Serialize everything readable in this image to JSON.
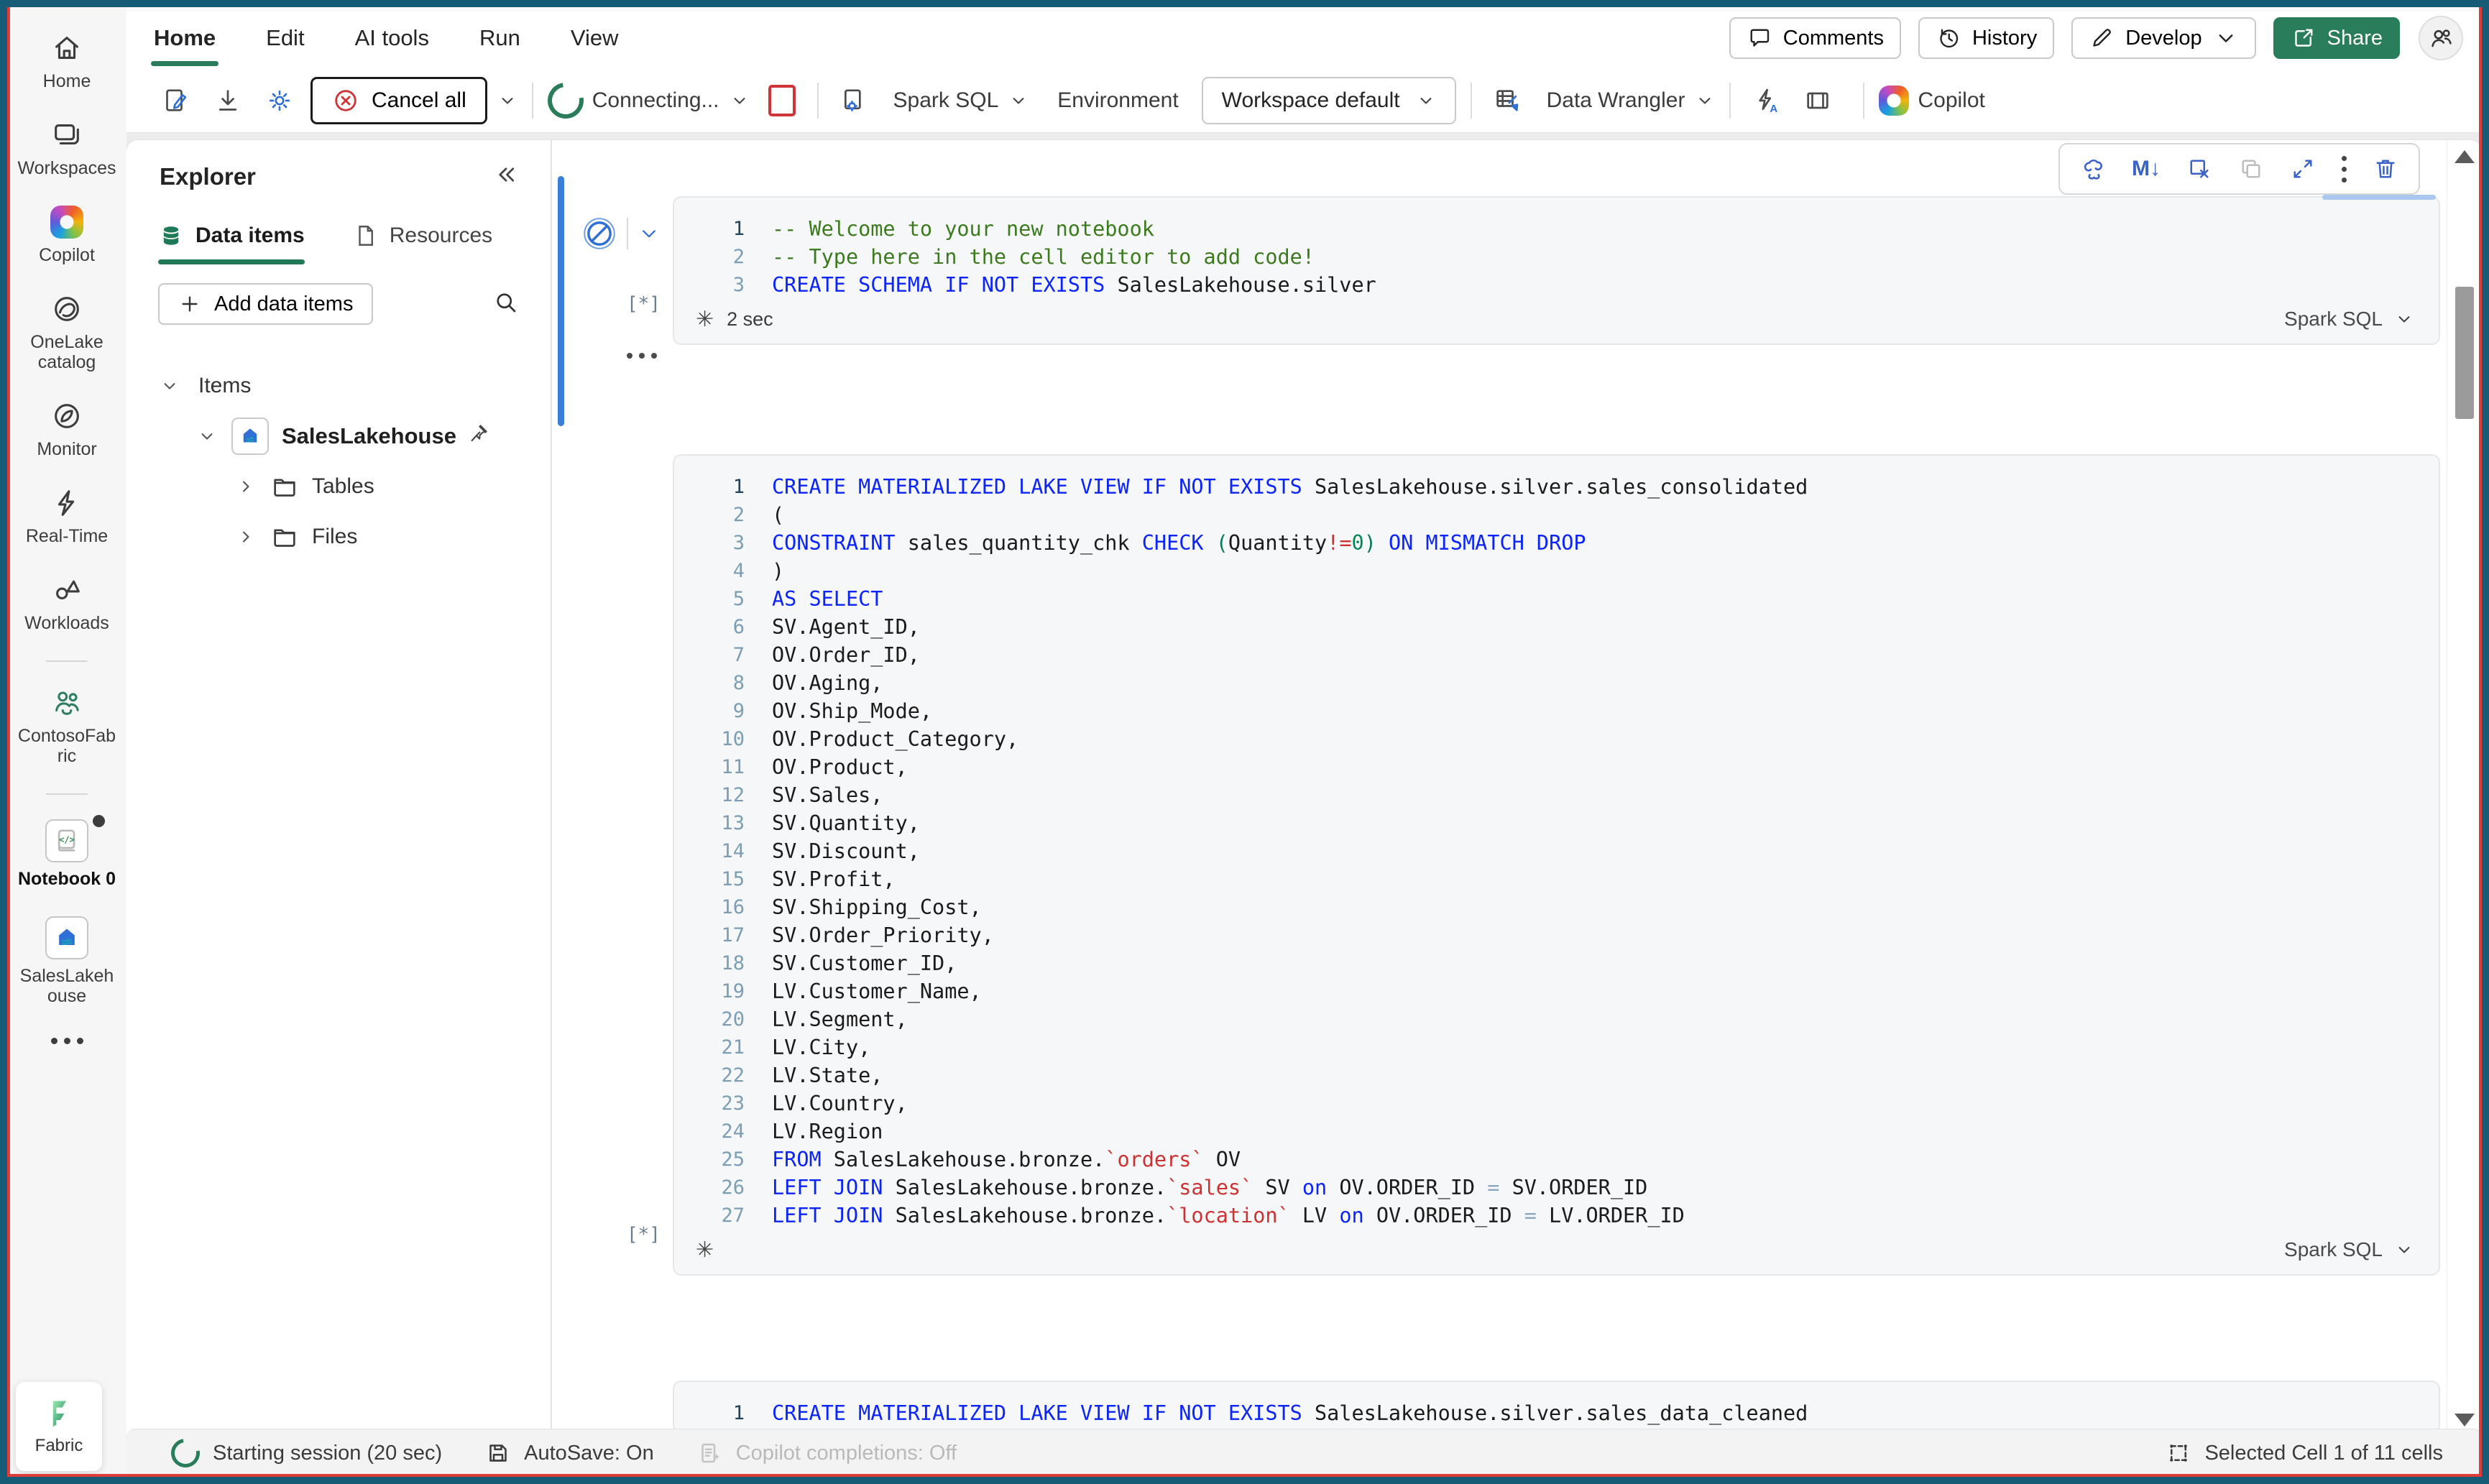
{
  "colors": {
    "frame_outer": "#175c77",
    "frame_inner_red": "#e23b3b",
    "accent_green": "#2a7d5b",
    "icon_blue": "#2f6fd6",
    "cell_selection_blue": "#377fd9",
    "keyword_blue": "#0b24fb",
    "comment_green": "#3c7a1e",
    "string_red": "#cd3131"
  },
  "menubar": {
    "tabs": [
      {
        "label": "Home",
        "active": true
      },
      {
        "label": "Edit"
      },
      {
        "label": "AI tools"
      },
      {
        "label": "Run"
      },
      {
        "label": "View"
      }
    ],
    "comments": "Comments",
    "history": "History",
    "develop": "Develop",
    "share": "Share"
  },
  "toolbar": {
    "cancel_all": "Cancel all",
    "session_status": "Connecting...",
    "language": "Spark SQL",
    "environment_label": "Environment",
    "environment_value": "Workspace default",
    "data_wrangler": "Data Wrangler",
    "copilot": "Copilot"
  },
  "rail": {
    "items": [
      {
        "label": "Home",
        "icon": "home-icon"
      },
      {
        "label": "Workspaces",
        "icon": "workspaces-icon"
      },
      {
        "label": "Copilot",
        "icon": "copilot-logo-icon"
      },
      {
        "label": "OneLake catalog",
        "icon": "onelake-icon"
      },
      {
        "label": "Monitor",
        "icon": "monitor-icon"
      },
      {
        "label": "Real-Time",
        "icon": "lightning-icon"
      },
      {
        "label": "Workloads",
        "icon": "workloads-icon"
      },
      {
        "label": "ContosoFabric",
        "icon": "people-icon"
      },
      {
        "label": "Notebook 0",
        "icon": "notebook-icon",
        "active": true,
        "unsaved_dot": true
      },
      {
        "label": "SalesLakehouse",
        "icon": "lakehouse-icon"
      }
    ],
    "more_icon": "ellipsis-icon",
    "footer": "Fabric"
  },
  "explorer": {
    "title": "Explorer",
    "tabs": [
      {
        "label": "Data items",
        "icon": "database-icon",
        "active": true
      },
      {
        "label": "Resources",
        "icon": "document-icon"
      }
    ],
    "add_button": "Add data items",
    "tree": {
      "root": "Items",
      "lakehouse": "SalesLakehouse",
      "folders": [
        "Tables",
        "Files"
      ]
    }
  },
  "notebook": {
    "cell_toolbar_icons": [
      "copilot-icon",
      "markdown-icon",
      "clear-cell-icon",
      "copy-icon",
      "expand-icon",
      "more-icon",
      "delete-icon"
    ],
    "cells": [
      {
        "exec_gutter": "[*]",
        "time": "2 sec",
        "lang": "Spark SQL",
        "lines": [
          [
            [
              "cm",
              "-- Welcome to your new notebook"
            ]
          ],
          [
            [
              "cm",
              "-- Type here in the cell editor to add code!"
            ]
          ],
          [
            [
              "kw",
              "CREATE SCHEMA IF NOT EXISTS"
            ],
            [
              "id",
              " SalesLakehouse.silver"
            ]
          ]
        ]
      },
      {
        "exec_gutter": "[*]",
        "lang": "Spark SQL",
        "lines": [
          [
            [
              "kw",
              "CREATE MATERIALIZED LAKE VIEW IF NOT EXISTS"
            ],
            [
              "id",
              " SalesLakehouse.silver.sales_consolidated"
            ]
          ],
          [
            [
              "id",
              "("
            ]
          ],
          [
            [
              "kw",
              "CONSTRAINT"
            ],
            [
              "id",
              " sales_quantity_chk "
            ],
            [
              "kw",
              "CHECK"
            ],
            [
              "id",
              " "
            ],
            [
              "brk",
              "("
            ],
            [
              "id",
              "Quantity"
            ],
            [
              "str",
              "!="
            ],
            [
              "num",
              "0"
            ],
            [
              "brk",
              ")"
            ],
            [
              "kw",
              " ON MISMATCH DROP"
            ]
          ],
          [
            [
              "id",
              ")"
            ]
          ],
          [
            [
              "kw",
              "AS SELECT"
            ]
          ],
          [
            [
              "id",
              "SV.Agent_ID,"
            ]
          ],
          [
            [
              "id",
              "OV.Order_ID,"
            ]
          ],
          [
            [
              "id",
              "OV.Aging,"
            ]
          ],
          [
            [
              "id",
              "OV.Ship_Mode,"
            ]
          ],
          [
            [
              "id",
              "OV.Product_Category,"
            ]
          ],
          [
            [
              "id",
              "OV.Product,"
            ]
          ],
          [
            [
              "id",
              "SV.Sales,"
            ]
          ],
          [
            [
              "id",
              "SV.Quantity,"
            ]
          ],
          [
            [
              "id",
              "SV.Discount,"
            ]
          ],
          [
            [
              "id",
              "SV.Profit,"
            ]
          ],
          [
            [
              "id",
              "SV.Shipping_Cost,"
            ]
          ],
          [
            [
              "id",
              "SV.Order_Priority,"
            ]
          ],
          [
            [
              "id",
              "SV.Customer_ID,"
            ]
          ],
          [
            [
              "id",
              "LV.Customer_Name,"
            ]
          ],
          [
            [
              "id",
              "LV.Segment,"
            ]
          ],
          [
            [
              "id",
              "LV.City,"
            ]
          ],
          [
            [
              "id",
              "LV.State,"
            ]
          ],
          [
            [
              "id",
              "LV.Country,"
            ]
          ],
          [
            [
              "id",
              "LV.Region"
            ]
          ],
          [
            [
              "kw",
              "FROM"
            ],
            [
              "id",
              " SalesLakehouse.bronze."
            ],
            [
              "str",
              "`orders`"
            ],
            [
              "id",
              " OV"
            ]
          ],
          [
            [
              "kw",
              "LEFT JOIN"
            ],
            [
              "id",
              " SalesLakehouse.bronze."
            ],
            [
              "str",
              "`sales`"
            ],
            [
              "id",
              " SV "
            ],
            [
              "kw",
              "on"
            ],
            [
              "id",
              " OV.ORDER_ID "
            ],
            [
              "op",
              "="
            ],
            [
              "id",
              " SV.ORDER_ID"
            ]
          ],
          [
            [
              "kw",
              "LEFT JOIN"
            ],
            [
              "id",
              " SalesLakehouse.bronze."
            ],
            [
              "str",
              "`location`"
            ],
            [
              "id",
              " LV "
            ],
            [
              "kw",
              "on"
            ],
            [
              "id",
              " OV.ORDER_ID "
            ],
            [
              "op",
              "="
            ],
            [
              "id",
              " LV.ORDER_ID"
            ]
          ]
        ]
      },
      {
        "lines": [
          [
            [
              "kw",
              "CREATE MATERIALIZED LAKE VIEW IF NOT EXISTS"
            ],
            [
              "id",
              " SalesLakehouse.silver.sales_data_cleaned"
            ]
          ]
        ]
      }
    ]
  },
  "statusbar": {
    "session": "Starting session (20 sec)",
    "autosave": "AutoSave: On",
    "copilot_completions": "Copilot completions: Off",
    "selection": "Selected Cell 1 of 11 cells"
  }
}
